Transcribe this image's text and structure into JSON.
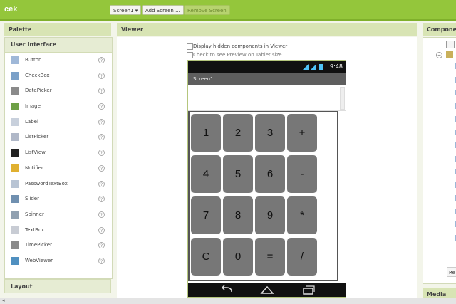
{
  "app": {
    "name": "cek"
  },
  "toolbar": {
    "screen_select": "Screen1 ▾",
    "add_screen": "Add Screen ...",
    "remove_screen": "Remove Screen"
  },
  "palette": {
    "title": "Palette",
    "category": "User Interface",
    "items": [
      {
        "label": "Button",
        "icon": "button-icon"
      },
      {
        "label": "CheckBox",
        "icon": "checkbox-icon"
      },
      {
        "label": "DatePicker",
        "icon": "datepicker-icon"
      },
      {
        "label": "Image",
        "icon": "image-icon"
      },
      {
        "label": "Label",
        "icon": "label-icon"
      },
      {
        "label": "ListPicker",
        "icon": "listpicker-icon"
      },
      {
        "label": "ListView",
        "icon": "listview-icon"
      },
      {
        "label": "Notifier",
        "icon": "notifier-icon"
      },
      {
        "label": "PasswordTextBox",
        "icon": "passwordtextbox-icon"
      },
      {
        "label": "Slider",
        "icon": "slider-icon"
      },
      {
        "label": "Spinner",
        "icon": "spinner-icon"
      },
      {
        "label": "TextBox",
        "icon": "textbox-icon"
      },
      {
        "label": "TimePicker",
        "icon": "timepicker-icon"
      },
      {
        "label": "WebViewer",
        "icon": "webviewer-icon"
      }
    ],
    "help_glyph": "?",
    "layout_category": "Layout"
  },
  "viewer": {
    "title": "Viewer",
    "hidden_label": "Display hidden components in Viewer",
    "tablet_label": "Check to see Preview on Tablet size",
    "phone": {
      "time": "9:48",
      "screen_title": "Screen1",
      "keys": [
        "1",
        "2",
        "3",
        "+",
        "4",
        "5",
        "6",
        "-",
        "7",
        "8",
        "9",
        "*",
        "C",
        "0",
        "=",
        "/"
      ]
    }
  },
  "components": {
    "title": "Componen"
  },
  "media": {
    "title": "Media"
  },
  "colors": {
    "topbar": "#94c63b",
    "panel_header": "#d8e4b4",
    "key": "#777777"
  }
}
